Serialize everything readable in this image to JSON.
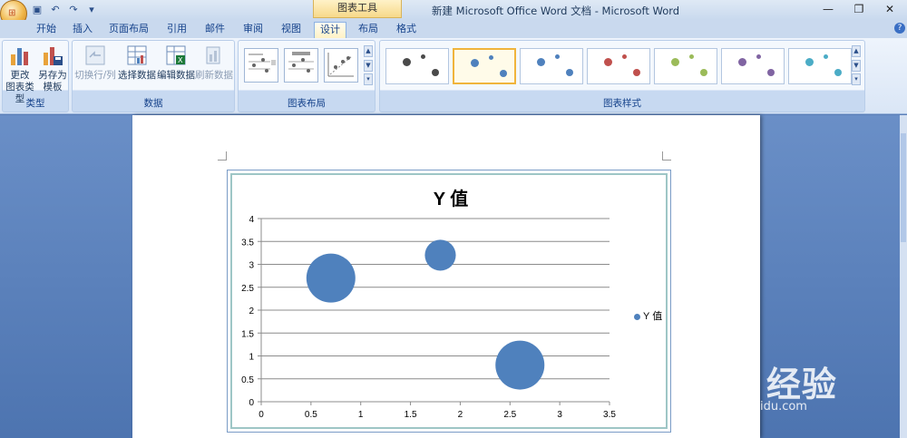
{
  "window": {
    "title": "新建 Microsoft Office Word 文档 - Microsoft Word",
    "contextual_tab": "图表工具",
    "controls": [
      "—",
      "❐",
      "✕"
    ]
  },
  "quick_access": [
    "save-icon",
    "undo-icon",
    "redo-icon",
    "customize-icon"
  ],
  "tabs": [
    {
      "label": "开始",
      "active": false
    },
    {
      "label": "插入",
      "active": false
    },
    {
      "label": "页面布局",
      "active": false
    },
    {
      "label": "引用",
      "active": false
    },
    {
      "label": "邮件",
      "active": false
    },
    {
      "label": "审阅",
      "active": false
    },
    {
      "label": "视图",
      "active": false
    },
    {
      "label": "设计",
      "active": true
    },
    {
      "label": "布局",
      "active": false
    },
    {
      "label": "格式",
      "active": false
    }
  ],
  "ribbon": {
    "type_group": {
      "label": "类型",
      "change_type": [
        "更改",
        "图表类型"
      ],
      "save_template": [
        "另存为",
        "模板"
      ]
    },
    "data_group": {
      "label": "数据",
      "switch_row_col": "切换行/列",
      "select_data": "选择数据",
      "edit_data": "编辑数据",
      "refresh_data": "刷新数据"
    },
    "layout_group": {
      "label": "图表布局"
    },
    "style_group": {
      "label": "图表样式",
      "colors": [
        "#4a4a4a",
        "#4f81bd",
        "#4f81bd",
        "#c0504d",
        "#9bbb59",
        "#8064a2",
        "#4bacc6"
      ]
    }
  },
  "chart_data": {
    "type": "bubble",
    "title": "Y 值",
    "xlim": [
      0,
      3.5
    ],
    "ylim": [
      0,
      4
    ],
    "x_ticks": [
      "0",
      "0.5",
      "1",
      "1.5",
      "2",
      "2.5",
      "3",
      "3.5"
    ],
    "y_ticks": [
      "0",
      "0.5",
      "1",
      "1.5",
      "2",
      "2.5",
      "3",
      "3.5",
      "4"
    ],
    "grid": true,
    "legend": "right",
    "series": [
      {
        "name": "Y 值",
        "color": "#4f81bd",
        "points": [
          {
            "x": 0.7,
            "y": 2.7,
            "size": 10
          },
          {
            "x": 1.8,
            "y": 3.2,
            "size": 4
          },
          {
            "x": 2.6,
            "y": 0.8,
            "size": 10
          }
        ]
      }
    ]
  },
  "watermark": {
    "main": "Bai 经验",
    "sub": "jingyan.baidu.com"
  }
}
